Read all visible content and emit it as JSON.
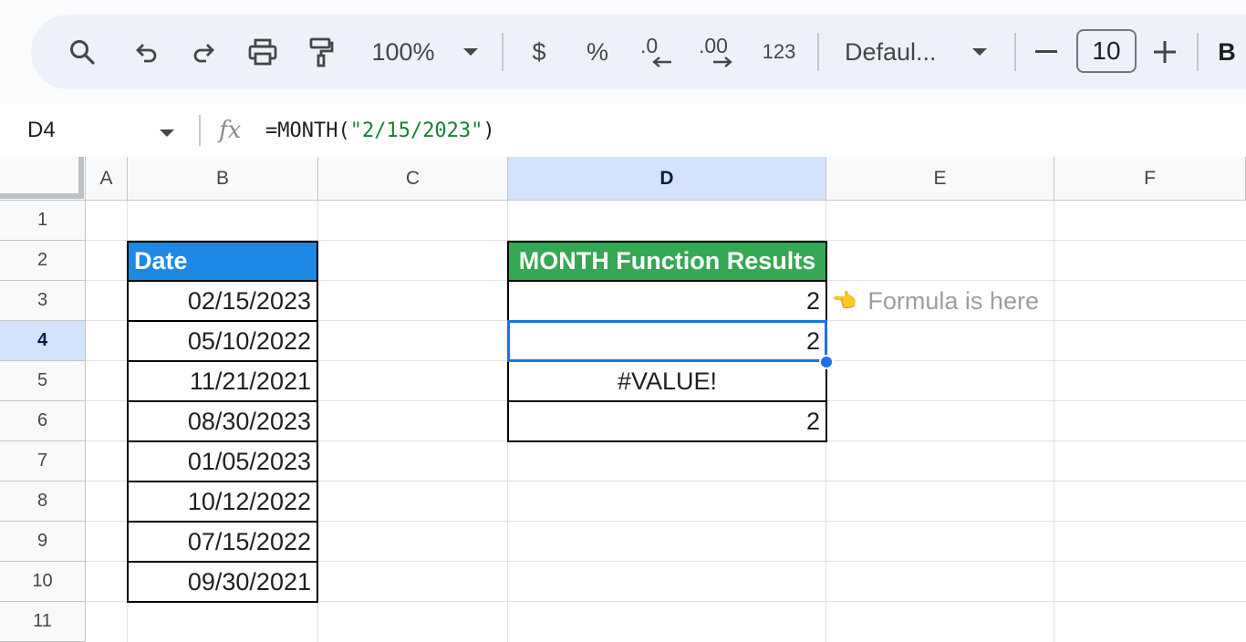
{
  "toolbar": {
    "zoom": "100%",
    "currency": "$",
    "percent": "%",
    "decrease_decimal": ".0",
    "increase_decimal": ".00",
    "more_formats": "123",
    "font": "Defaul...",
    "font_size": "10",
    "bold": "B",
    "icons": [
      "search-icon",
      "undo-icon",
      "redo-icon",
      "print-icon",
      "paint-format-icon",
      "chevron-down-icon",
      "minus-icon",
      "plus-icon"
    ]
  },
  "formula_bar": {
    "name_box": "D4",
    "fx": "fx",
    "formula_prefix": "=MONTH(",
    "formula_string": "\"2/15/2023\"",
    "formula_suffix": ")"
  },
  "columns": [
    "A",
    "B",
    "C",
    "D",
    "E",
    "F"
  ],
  "selected_column": "D",
  "rows": [
    "1",
    "2",
    "3",
    "4",
    "5",
    "6",
    "7",
    "8",
    "9",
    "10",
    "11"
  ],
  "selected_row": "4",
  "date_table": {
    "header": "Date",
    "values": [
      "02/15/2023",
      "05/10/2022",
      "11/21/2021",
      "08/30/2023",
      "01/05/2023",
      "10/12/2022",
      "07/15/2022",
      "09/30/2021"
    ]
  },
  "results_table": {
    "header": "MONTH Function Results",
    "values": [
      "2",
      "2",
      "#VALUE!",
      "2"
    ]
  },
  "annotation": {
    "emoji": "👈",
    "text": "Formula is here"
  },
  "colors": {
    "date_header_bg": "#1e88e5",
    "results_header_bg": "#34a853",
    "selection": "#1a73e8",
    "formula_string": "#188038"
  }
}
